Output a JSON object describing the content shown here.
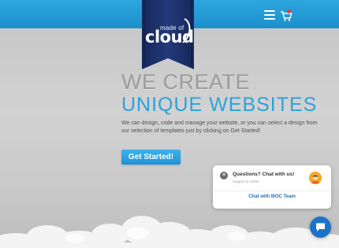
{
  "header": {
    "logo": {
      "made_of": "made of",
      "cloud": "cloud"
    },
    "menu_icon": "hamburger-menu-icon",
    "cart_icon": "shopping-cart-icon",
    "brand_color": "#1b8fcc",
    "ribbon_color": "#1c2f6b"
  },
  "hero": {
    "headline_line1": "WE CREATE",
    "headline_line2": "UNIQUE WEBSITES",
    "description": "We can design, code and manage your website, or you can select a design from our selection of templates just by clicking on Get Started!",
    "cta_label": "Get Started!"
  },
  "chat_widget": {
    "title": "Questions? Chat with us!",
    "subtitle": "Support is online",
    "link_label": "Chat with MOC Team",
    "close_icon": "close-icon",
    "avatar_icon": "agent-avatar-icon",
    "launcher_icon": "chat-bubble-icon"
  }
}
